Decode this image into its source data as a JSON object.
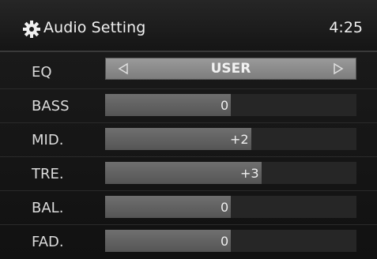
{
  "header": {
    "icon": "gear-icon",
    "title": "Audio Setting",
    "time": "4:25"
  },
  "eq": {
    "label": "EQ",
    "value": "USER",
    "left_icon": "triangle-left-icon",
    "right_icon": "triangle-right-icon"
  },
  "settings": [
    {
      "label": "BASS",
      "value": "0",
      "level": 0
    },
    {
      "label": "MID.",
      "value": "+2",
      "level": 2
    },
    {
      "label": "TRE.",
      "value": "+3",
      "level": 3
    },
    {
      "label": "BAL.",
      "value": "0",
      "level": 0
    },
    {
      "label": "FAD.",
      "value": "0",
      "level": 0
    }
  ]
}
